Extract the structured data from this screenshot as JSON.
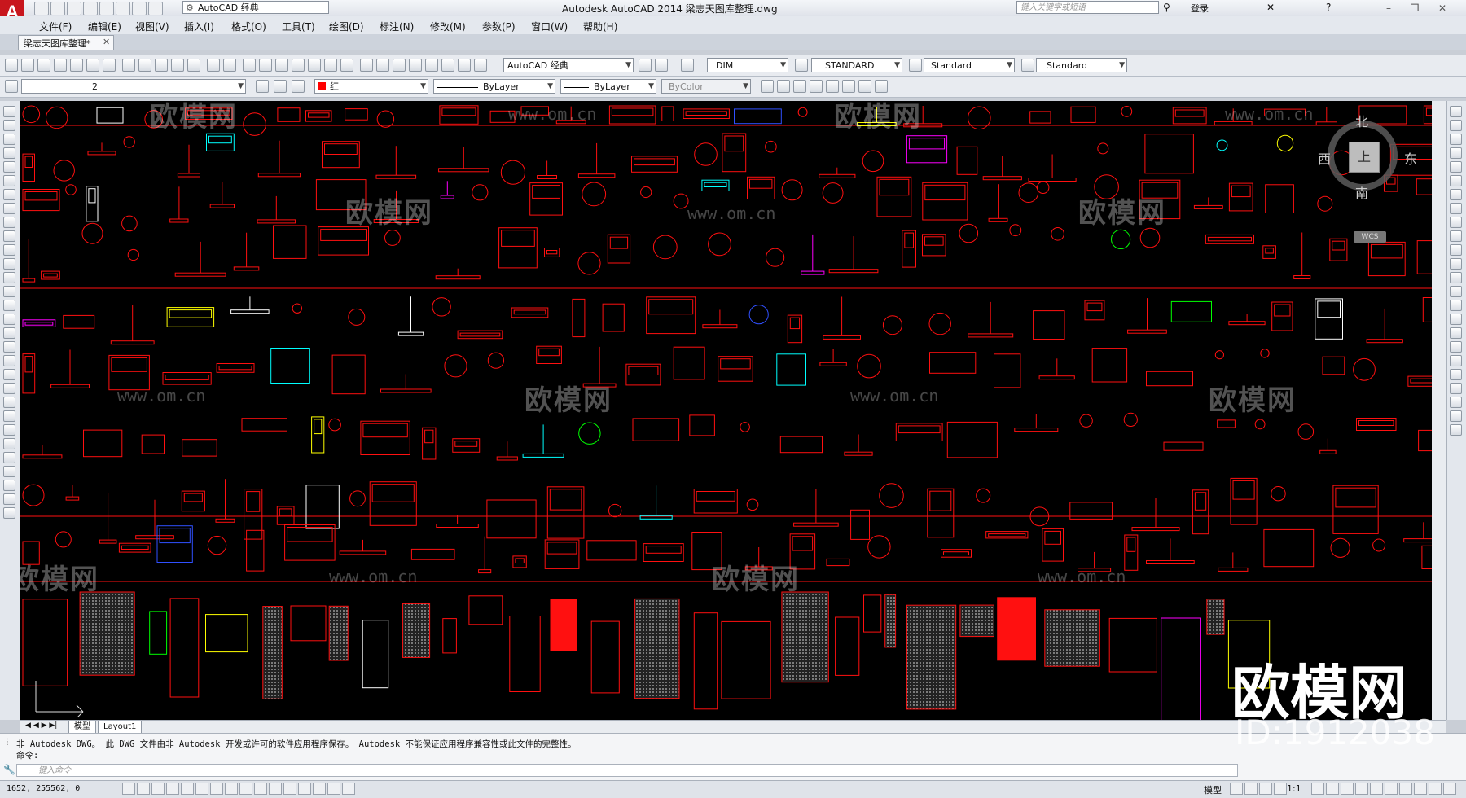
{
  "titlebar": {
    "app_logo": "A",
    "workspace": "AutoCAD 经典",
    "title": "Autodesk AutoCAD 2014    梁志天图库整理.dwg",
    "search_placeholder": "键入关键字或短语",
    "login": "登录"
  },
  "menus": [
    "文件(F)",
    "编辑(E)",
    "视图(V)",
    "插入(I)",
    "格式(O)",
    "工具(T)",
    "绘图(D)",
    "标注(N)",
    "修改(M)",
    "参数(P)",
    "窗口(W)",
    "帮助(H)"
  ],
  "doc_tab": "梁志天图库整理*",
  "toolbar1": {
    "workspace": "AutoCAD 经典",
    "dim_style": "DIM",
    "text_style": "STANDARD",
    "table_style": "Standard",
    "multileader_style": "Standard"
  },
  "toolbar2": {
    "layer": "2",
    "color": "红",
    "linetype": "ByLayer",
    "lineweight": "ByLayer",
    "plotstyle": "ByColor"
  },
  "viewcube": {
    "north": "北",
    "west": "西",
    "east": "东",
    "south": "南",
    "top": "上",
    "wcs": "WCS"
  },
  "layout_tabs": [
    "模型",
    "Layout1"
  ],
  "command": {
    "history1": "非 Autodesk DWG。 此 DWG 文件由非 Autodesk 开发或许可的软件应用程序保存。 Autodesk 不能保证应用程序兼容性或此文件的完整性。",
    "history2": "命令:",
    "input_placeholder": "键入命令"
  },
  "status": {
    "coords": "1652,  255562, 0",
    "model": "模型",
    "scale": "1:1"
  },
  "watermark": {
    "text": "欧模网",
    "url": "www.om.cn",
    "brand": "欧模网",
    "id": "ID:1912038"
  },
  "colors": {
    "canvas": "#000000",
    "drawing": "#ff1010",
    "accent": "#c8161d"
  }
}
